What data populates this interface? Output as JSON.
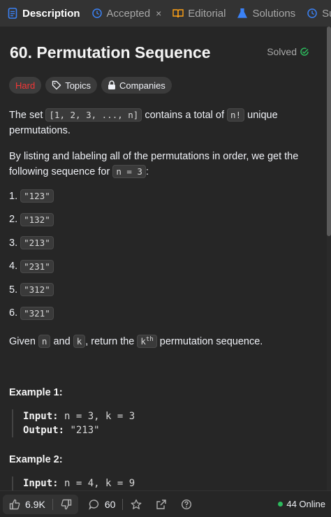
{
  "tabs": {
    "description": "Description",
    "accepted": "Accepted",
    "accepted_close": "×",
    "editorial": "Editorial",
    "solutions": "Solutions",
    "submissions_partial": "Sul"
  },
  "problem": {
    "title": "60. Permutation Sequence",
    "status": "Solved",
    "difficulty": "Hard",
    "topics": "Topics",
    "companies": "Companies"
  },
  "body": {
    "p1_a": "The set ",
    "p1_code1": "[1, 2, 3, ..., n]",
    "p1_b": " contains a total of ",
    "p1_code2": "n!",
    "p1_c": " unique permutations.",
    "p2_a": "By listing and labeling all of the permutations in order, we get the following sequence for ",
    "p2_code": "n = 3",
    "p2_b": ":",
    "items": [
      {
        "num": "1.",
        "value": "\"123\""
      },
      {
        "num": "2.",
        "value": "\"132\""
      },
      {
        "num": "3.",
        "value": "\"213\""
      },
      {
        "num": "4.",
        "value": "\"231\""
      },
      {
        "num": "5.",
        "value": "\"312\""
      },
      {
        "num": "6.",
        "value": "\"321\""
      }
    ],
    "p3_a": "Given ",
    "p3_n": "n",
    "p3_b": " and ",
    "p3_k": "k",
    "p3_c": ", return the ",
    "p3_kth_base": "k",
    "p3_kth_sup": "th",
    "p3_d": " permutation sequence."
  },
  "examples": [
    {
      "head": "Example 1:",
      "input_label": "Input:",
      "input": " n = 3, k = 3",
      "output_label": "Output:",
      "output": " \"213\""
    },
    {
      "head": "Example 2:",
      "input_label": "Input:",
      "input": " n = 4, k = 9"
    }
  ],
  "footer": {
    "likes": "6.9K",
    "comments": "60",
    "online": "44 Online"
  },
  "colors": {
    "accent_green": "#2cbb5d",
    "hard": "#f63636",
    "tab_blue": "#3b82f6"
  }
}
